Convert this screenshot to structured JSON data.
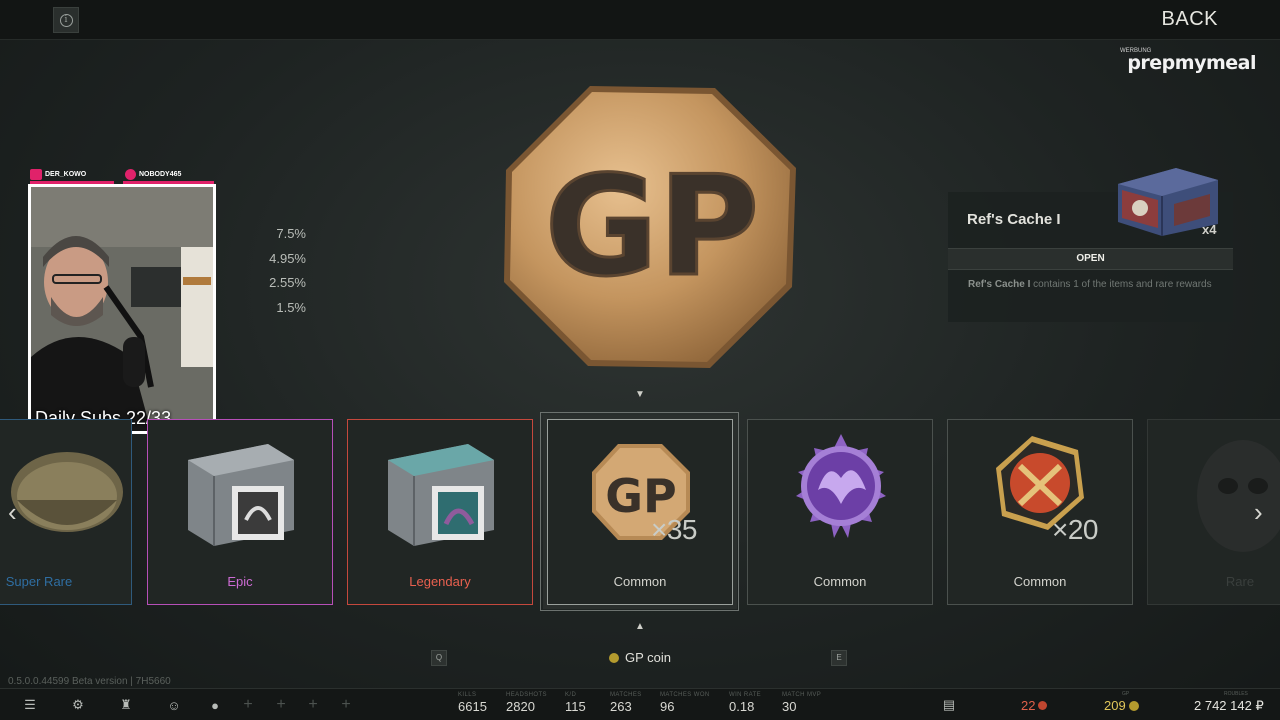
{
  "header": {
    "back_label": "BACK"
  },
  "ad": {
    "tag": "WERBUNG",
    "brand": "prepmymeal"
  },
  "stream": {
    "streamer": "DER_KOWO",
    "follower": "NOBODY465",
    "follower_caption": "FOLLOWER",
    "overlay_text": "Daily Subs 22/33"
  },
  "odds": [
    "7.5%",
    "4.95%",
    "2.55%",
    "1.5%"
  ],
  "cache": {
    "title": "Ref's Cache I",
    "quantity": "x4",
    "open_label": "OPEN",
    "desc_name": "Ref's Cache I",
    "desc_rest": " contains 1 of the items and rare rewards"
  },
  "carousel": {
    "items": [
      {
        "rarity": "Super Rare",
        "icon": "helmet-icon"
      },
      {
        "rarity": "Epic",
        "icon": "box-icon"
      },
      {
        "rarity": "Legendary",
        "icon": "box-icon"
      },
      {
        "rarity": "Common",
        "icon": "gp-coin-icon",
        "qty": "×35"
      },
      {
        "rarity": "Common",
        "icon": "phoenix-emblem-icon"
      },
      {
        "rarity": "Common",
        "icon": "swords-badge-icon",
        "qty": "×20"
      },
      {
        "rarity": "Rare",
        "icon": "mask-icon"
      }
    ],
    "prev_arrow": "‹",
    "next_arrow": "›"
  },
  "selection": {
    "name": "GP coin",
    "prev_key": "Q",
    "next_key": "E"
  },
  "version": "0.5.0.0.44599 Beta version | 7H5660",
  "stats": [
    {
      "label": "KILLS",
      "value": "6615"
    },
    {
      "label": "HEADSHOTS",
      "value": "2820"
    },
    {
      "label": "K/D",
      "value": "115"
    },
    {
      "label": "MATCHES",
      "value": "263"
    },
    {
      "label": "MATCHES WON",
      "value": "96"
    },
    {
      "label": "WIN RATE",
      "value": "0.18"
    },
    {
      "label": "MATCH MVP",
      "value": "30"
    }
  ],
  "currency": {
    "gp_label": "GP",
    "gp": "209",
    "bc": "22",
    "roubles_label": "ROUBLES",
    "roubles": "2 742 142 ₽"
  },
  "colors": {
    "epic": "#cc6bd3",
    "legendary": "#e8604f",
    "super_rare": "#2f6ea2",
    "gp_gold": "#c89a5a"
  }
}
